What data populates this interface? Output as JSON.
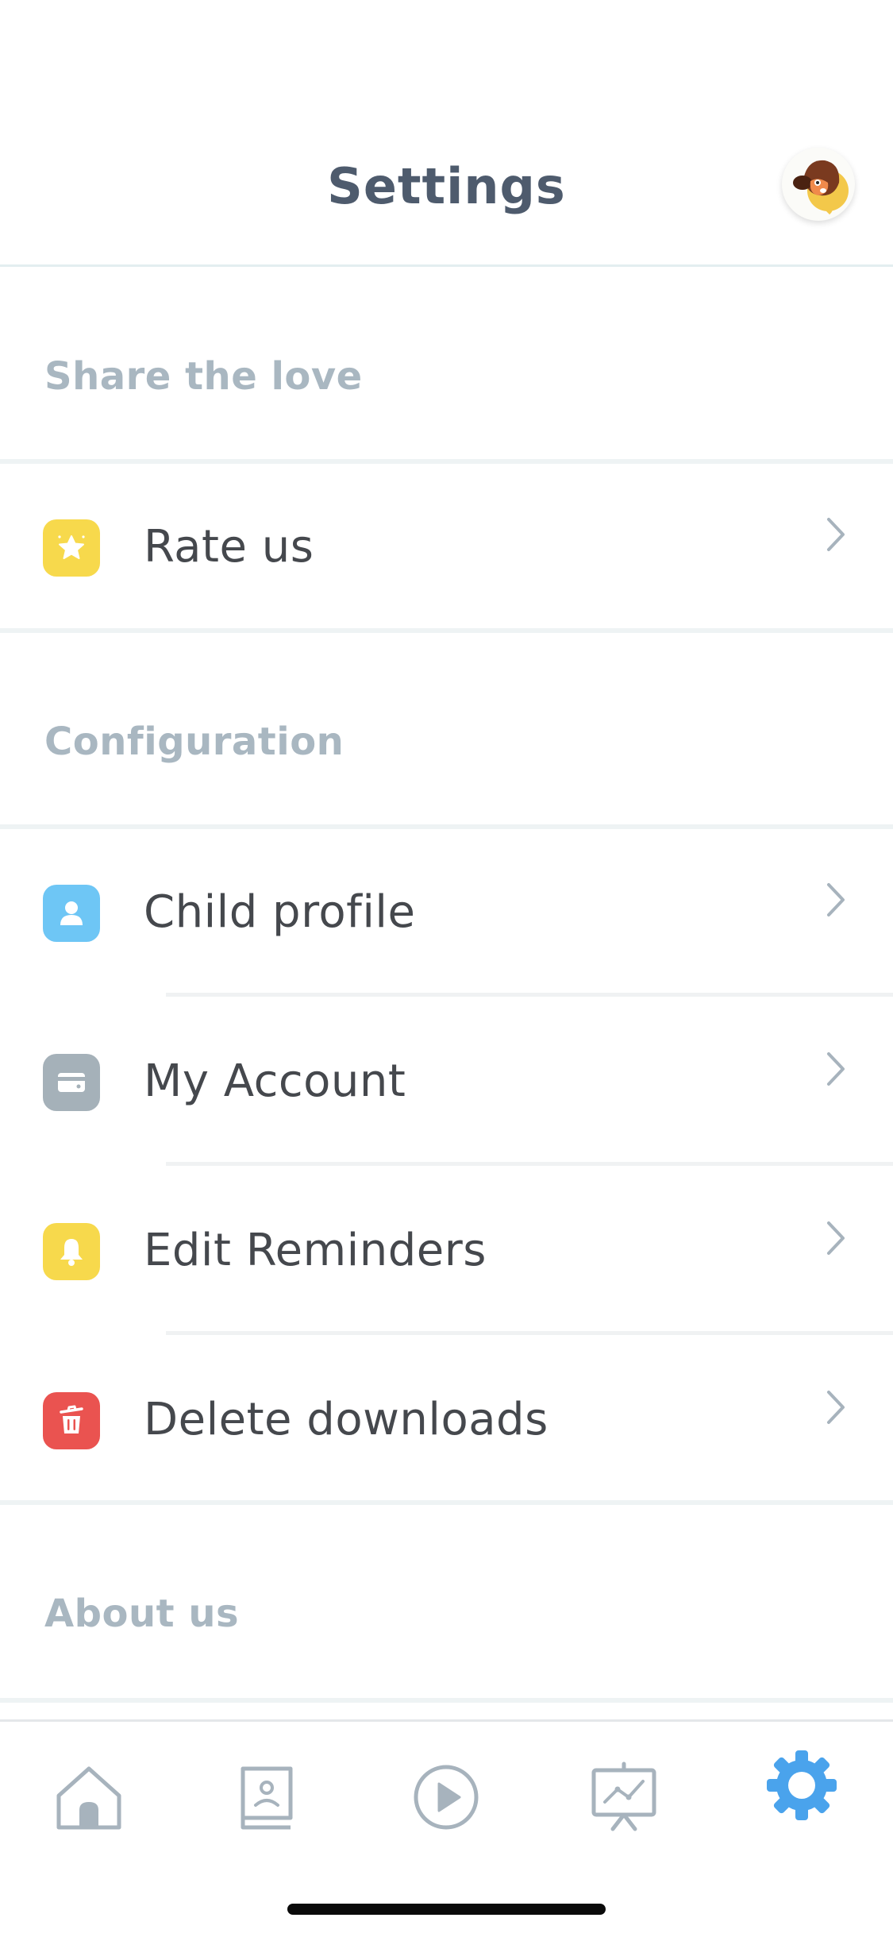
{
  "header": {
    "title": "Settings",
    "avatar": "puppy-avatar-icon"
  },
  "sections": [
    {
      "title": "Share the love",
      "items": [
        {
          "label": "Rate us",
          "icon": "star-badge-icon",
          "color": "#f7d94c"
        }
      ]
    },
    {
      "title": "Configuration",
      "items": [
        {
          "label": "Child profile",
          "icon": "child-profile-icon",
          "color": "#6ec6f5"
        },
        {
          "label": "My Account",
          "icon": "credit-card-icon",
          "color": "#a5b1b9"
        },
        {
          "label": "Edit Reminders",
          "icon": "bell-icon",
          "color": "#f7d94c"
        },
        {
          "label": "Delete downloads",
          "icon": "trash-icon",
          "color": "#ea5350"
        }
      ]
    },
    {
      "title": "About us",
      "items": []
    }
  ],
  "tabbar": {
    "items": [
      {
        "name": "home",
        "icon": "home-icon",
        "active": false
      },
      {
        "name": "library",
        "icon": "book-profile-icon",
        "active": false
      },
      {
        "name": "play",
        "icon": "play-icon",
        "active": false
      },
      {
        "name": "progress",
        "icon": "chart-board-icon",
        "active": false
      },
      {
        "name": "settings",
        "icon": "gear-icon",
        "active": true
      }
    ],
    "active_color": "#4aa3ec",
    "inactive_color": "#a7b3bd"
  }
}
